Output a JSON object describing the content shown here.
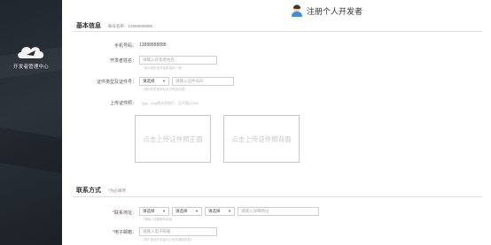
{
  "sidebar": {
    "brand": "开发者管理中心"
  },
  "header": {
    "title": "注册个人开发者"
  },
  "basic": {
    "title": "基本信息",
    "account_label": "账号名称：",
    "account_value": "13888888888",
    "phone_label": "手机号码：",
    "phone_value": "13888888888",
    "name_label": "开发者姓名：",
    "name_placeholder": "请输入开发者姓名",
    "name_hint": "（请与身份证件信息保持一致）",
    "id_label": "证件类型及证件号：",
    "id_type_value": "请选择",
    "id_number_placeholder": "请输入证件号码",
    "id_hint": "（请在开发者资料页中修改信息）",
    "upload_label": "上传证件照：",
    "upload_hint": "（jpg、png格式的图片，且不超过2M）",
    "upload_front": "点击上传证件照正面",
    "upload_back": "点击上传证件照背面"
  },
  "contact": {
    "title": "联系方式",
    "required_note": "*为必填项",
    "address_label": "联系地址：",
    "province_value": "请选择",
    "city_value": "请选择",
    "district_value": "请选择",
    "address_placeholder": "请输入详细地址",
    "address_hint": "（请输入详细联系地址）",
    "email_label": "电子邮箱：",
    "email_placeholder": "请输入电子邮箱",
    "email_hint": "（用于接收开发者中心相关通知信息）"
  },
  "colors": {
    "sidebar_bg": "#262c33",
    "required": "#e53935",
    "border": "#cfcfcf"
  }
}
